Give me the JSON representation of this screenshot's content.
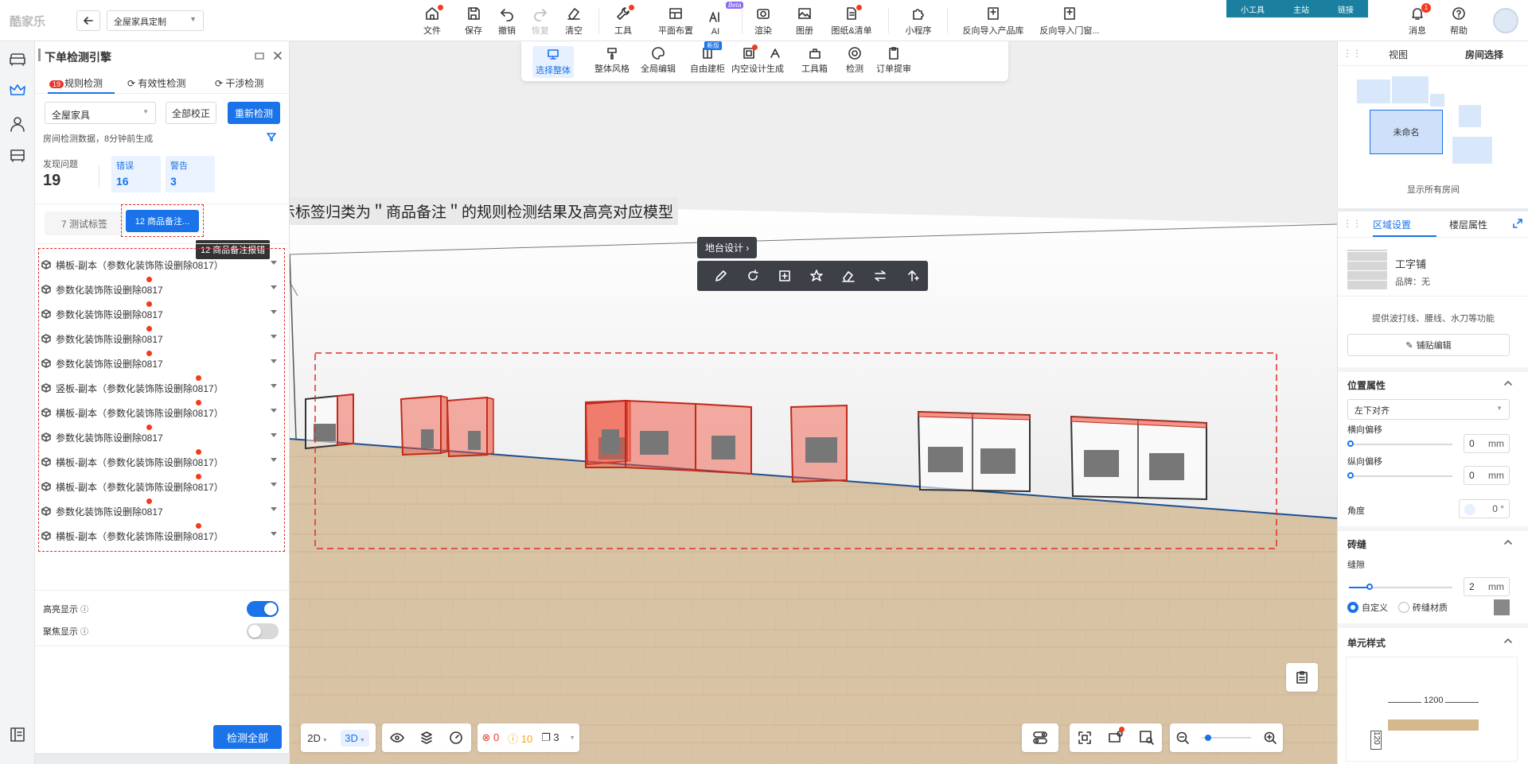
{
  "app": {
    "logo": "酷家乐",
    "project": "全屋家具定制"
  },
  "toolbar": {
    "items": [
      {
        "label": "文件",
        "icon": "home-icon"
      },
      {
        "label": "保存",
        "icon": "save-icon"
      },
      {
        "label": "撤销",
        "icon": "undo-icon"
      },
      {
        "label": "恢复",
        "icon": "redo-icon"
      },
      {
        "label": "清空",
        "icon": "eraser-icon"
      },
      {
        "label": "工具",
        "icon": "wrench-icon"
      },
      {
        "label": "平面布置",
        "icon": "layout-icon"
      },
      {
        "label": "AI",
        "icon": "ai-icon"
      },
      {
        "label": "渲染",
        "icon": "camera-icon"
      },
      {
        "label": "图册",
        "icon": "album-icon"
      },
      {
        "label": "图纸&清单",
        "icon": "document-icon"
      },
      {
        "label": "小程序",
        "icon": "puzzle-icon"
      },
      {
        "label": "反向导入产品库",
        "icon": "import-icon"
      },
      {
        "label": "反向导入门窗...",
        "icon": "import-door-icon"
      }
    ],
    "beta": "Beta",
    "pill": [
      "小工具",
      "主站",
      "链接"
    ],
    "messages": "消息",
    "messages_badge": "1",
    "help": "帮助"
  },
  "subtoolbar": {
    "items": [
      "选择整体",
      "整体风格",
      "全局编辑",
      "自由建柜",
      "内空设计",
      "生成",
      "工具箱",
      "检测",
      "订单提审"
    ],
    "new_badge": "新版"
  },
  "panel": {
    "title": "下单检测引擎",
    "tabs": [
      {
        "badge": "19",
        "label": "规则检测"
      },
      {
        "label": "有效性检测"
      },
      {
        "label": "干涉检测"
      }
    ],
    "scope": "全屋家具",
    "btn_all_fix": "全部校正",
    "btn_recheck": "重新检测",
    "note": "房间检测数据，8分钟前生成",
    "found_label": "发现问题",
    "found_value": "19",
    "error_label": "错误",
    "error_value": "16",
    "warn_label": "警告",
    "warn_value": "3",
    "tag_test": "7 测试标签",
    "tag_goods": "12 商品备注...",
    "tooltip": "12 商品备注报错",
    "items": [
      "横板-副本（参数化装饰陈设删除0817）",
      "参数化装饰陈设删除0817",
      "参数化装饰陈设删除0817",
      "参数化装饰陈设删除0817",
      "参数化装饰陈设删除0817",
      "竖板-副本（参数化装饰陈设删除0817）",
      "横板-副本（参数化装饰陈设删除0817）",
      "参数化装饰陈设删除0817",
      "横板-副本（参数化装饰陈设删除0817）",
      "横板-副本（参数化装饰陈设删除0817）",
      "参数化装饰陈设删除0817",
      "横板-副本（参数化装饰陈设删除0817）"
    ],
    "highlight_label": "高亮显示",
    "highlight_on": 1,
    "focus_label": "聚焦显示",
    "focus_on": 0,
    "check_all": "检测全部"
  },
  "viewport": {
    "annotation": "仅显示标签归类为＂商品备注＂的规则检测结果及高亮对应模型",
    "floating_label": "地台设计",
    "view2d": "2D",
    "view3d": "3D",
    "errors": "0",
    "warnings": "10",
    "copies": "3"
  },
  "right": {
    "tabs_top": [
      "视图",
      "房间选择"
    ],
    "room_name": "未命名",
    "show_all_rooms": "显示所有房间",
    "tabs": [
      "区域设置",
      "楼层属性"
    ],
    "material_name": "工字铺",
    "brand": "品牌：无",
    "desc": "提供波打线、腰线、水刀等功能",
    "edit_btn": "铺贴编辑",
    "position_title": "位置属性",
    "align": "左下对齐",
    "h_offset_label": "横向偏移",
    "h_offset": "0",
    "v_offset_label": "纵向偏移",
    "v_offset": "0",
    "angle_label": "角度",
    "angle": "0 °",
    "gap_title": "砖缝",
    "gap_label": "缝隙",
    "gap": "2",
    "unit": "mm",
    "radio_custom": "自定义",
    "radio_material": "砖缝材质",
    "unit_style_title": "单元样式",
    "dim_w": "1200",
    "dim_h": "120"
  },
  "colors": {
    "accent": "#1a73e8",
    "error": "#e8352b",
    "highlight": "#f0402a"
  }
}
